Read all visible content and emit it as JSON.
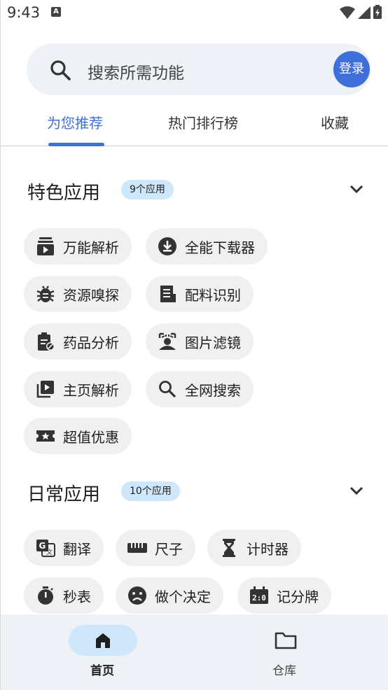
{
  "status": {
    "time": "9:43",
    "notif_badge": "A"
  },
  "search": {
    "placeholder": "搜索所需功能",
    "login_label": "登录"
  },
  "tabs": [
    {
      "label": "为您推荐",
      "active": true
    },
    {
      "label": "热门排行榜",
      "active": false
    },
    {
      "label": "收藏",
      "active": false
    }
  ],
  "sections": [
    {
      "title": "特色应用",
      "badge": "9个应用",
      "items": [
        {
          "label": "万能解析",
          "icon": "video-play-icon"
        },
        {
          "label": "全能下载器",
          "icon": "download-icon"
        },
        {
          "label": "资源嗅探",
          "icon": "bug-icon"
        },
        {
          "label": "配料识别",
          "icon": "receipt-icon"
        },
        {
          "label": "药品分析",
          "icon": "clipboard-icon"
        },
        {
          "label": "图片滤镜",
          "icon": "image-filter-icon"
        },
        {
          "label": "主页解析",
          "icon": "video-library-icon"
        },
        {
          "label": "全网搜索",
          "icon": "search-icon"
        },
        {
          "label": "超值优惠",
          "icon": "ticket-icon"
        }
      ]
    },
    {
      "title": "日常应用",
      "badge": "10个应用",
      "items": [
        {
          "label": "翻译",
          "icon": "translate-icon"
        },
        {
          "label": "尺子",
          "icon": "ruler-icon"
        },
        {
          "label": "计时器",
          "icon": "hourglass-icon"
        },
        {
          "label": "秒表",
          "icon": "stopwatch-icon"
        },
        {
          "label": "做个决定",
          "icon": "decision-face-icon"
        },
        {
          "label": "记分牌",
          "icon": "scoreboard-icon"
        }
      ]
    }
  ],
  "bottom_nav": [
    {
      "label": "首页",
      "icon": "home-icon",
      "active": true
    },
    {
      "label": "仓库",
      "icon": "folder-icon",
      "active": false
    }
  ],
  "colors": {
    "accent": "#3f6fd8",
    "badge_bg": "#cfe7fb",
    "chip_bg": "#f0f0f0",
    "search_bg": "#eef1f6"
  }
}
